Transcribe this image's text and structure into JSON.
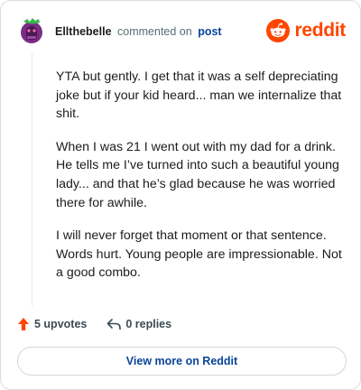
{
  "header": {
    "author": "Ellthebelle",
    "action": "commented on",
    "target_link": "post",
    "brand_icon": "reddit-snoo-icon",
    "brand_name": "reddit"
  },
  "comment": {
    "paragraphs": [
      "YTA but gently. I get that it was a self depreciating joke but if your kid heard... man we internalize that shit.",
      "When I was 21 I went out with my dad for a drink. He tells me I’ve turned into such a beautiful young lady... and that he’s glad because he was worried there for awhile.",
      "I will never forget that moment or that sentence. Words hurt. Young people are impressionable. Not a good combo."
    ]
  },
  "footer": {
    "upvotes_icon": "upvote-arrow-icon",
    "upvotes_label": "5 upvotes",
    "replies_icon": "reply-arrow-icon",
    "replies_label": "0 replies"
  },
  "cta": {
    "label": "View more on Reddit"
  },
  "colors": {
    "brand": "#ff4500",
    "link": "#0a449b",
    "muted": "#576f76",
    "avatar_bg": "#7b2d84",
    "avatar_accent": "#35b84a"
  }
}
